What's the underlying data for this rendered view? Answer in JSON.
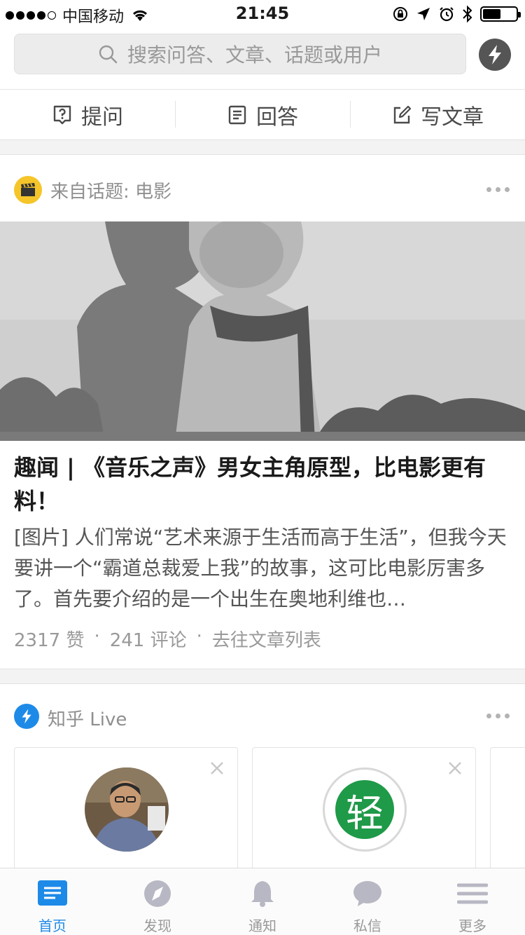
{
  "status_bar": {
    "carrier": "中国移动",
    "time": "21:45"
  },
  "search": {
    "placeholder": "搜索问答、文章、话题或用户"
  },
  "actions": [
    {
      "label": "提问",
      "icon": "question-icon"
    },
    {
      "label": "回答",
      "icon": "document-icon"
    },
    {
      "label": "写文章",
      "icon": "edit-icon"
    }
  ],
  "feed": {
    "topic_card": {
      "source": "来自话题: 电影",
      "title": "趣闻 | 《音乐之声》男女主角原型，比电影更有料！",
      "excerpt": "[图片] 人们常说“艺术来源于生活而高于生活”，但我今天要讲一个“霸道总裁爱上我”的故事，这可比电影厉害多了。首先要介绍的是一个出生在奥地利维也…",
      "likes": "2317 赞",
      "comments": "241 评论",
      "link": "去往文章列表",
      "dot": "·"
    },
    "live_card": {
      "title": "知乎 Live",
      "badge_text": "轻"
    }
  },
  "tabs": [
    {
      "label": "首页",
      "icon": "home-icon",
      "active": true
    },
    {
      "label": "发现",
      "icon": "compass-icon",
      "active": false
    },
    {
      "label": "通知",
      "icon": "bell-icon",
      "active": false
    },
    {
      "label": "私信",
      "icon": "message-icon",
      "active": false
    },
    {
      "label": "更多",
      "icon": "menu-icon",
      "active": false
    }
  ],
  "colors": {
    "accent": "#1e8ae8",
    "topic_badge": "#f5c52a"
  }
}
